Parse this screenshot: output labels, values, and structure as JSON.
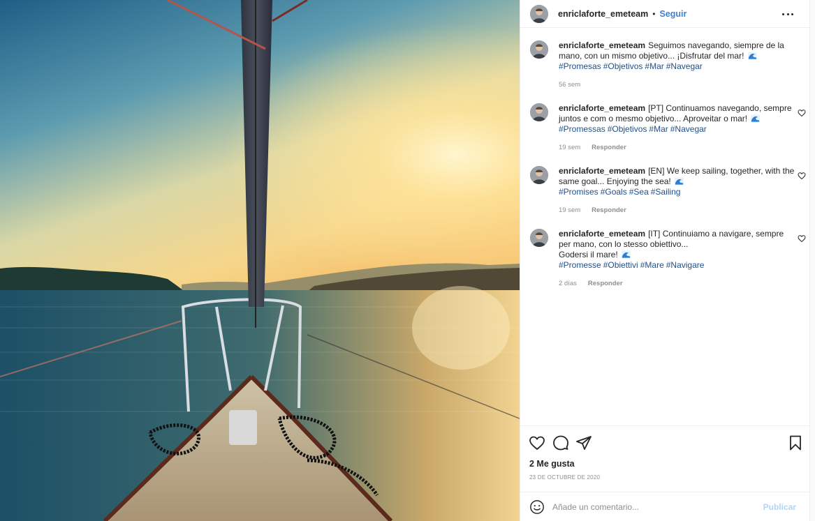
{
  "post": {
    "username": "enriclaforte_emeteam",
    "dot": "•",
    "follow_label": "Seguir",
    "more_icon": "more-horizontal-icon"
  },
  "comments": [
    {
      "user": "enriclaforte_emeteam",
      "text": "Seguimos navegando, siempre de la mano, con un mismo objetivo... ¡Disfrutar del mar!",
      "hashtags": [
        "#Promesas",
        "#Objetivos",
        "#Mar",
        "#Navegar"
      ],
      "time": "56 sem",
      "reply": ""
    },
    {
      "user": "enriclaforte_emeteam",
      "text": "[PT] Continuamos navegando, sempre juntos e com o mesmo objetivo... Aproveitar o mar!",
      "hashtags": [
        "#Promessas",
        "#Objetivos",
        "#Mar",
        "#Navegar"
      ],
      "time": "19 sem",
      "reply": "Responder"
    },
    {
      "user": "enriclaforte_emeteam",
      "text": "[EN] We keep sailing, together, with the same goal... Enjoying the sea!",
      "hashtags": [
        "#Promises",
        "#Goals",
        "#Sea",
        "#Sailing"
      ],
      "time": "19 sem",
      "reply": "Responder"
    },
    {
      "user": "enriclaforte_emeteam",
      "text": "[IT] Continuiamo a navigare, sempre per mano, con lo stesso obiettivo...",
      "text2": "Godersi il mare!",
      "hashtags": [
        "#Promesse",
        "#Obiettivi",
        "#Mare",
        "#Navigare"
      ],
      "time": "2 días",
      "reply": "Responder"
    }
  ],
  "actions": {
    "icons": [
      "heart-icon",
      "comment-icon",
      "share-icon",
      "bookmark-icon"
    ],
    "likes": "2 Me gusta",
    "date": "23 DE OCTUBRE DE 2020"
  },
  "comment_box": {
    "placeholder": "Añade un comentario...",
    "publish_label": "Publicar"
  },
  "colors": {
    "link_blue": "#3f7fd3",
    "hashtag_blue": "#1f4f8c",
    "publish_disabled": "#b3d4f7",
    "muted": "#8e8e8e"
  }
}
